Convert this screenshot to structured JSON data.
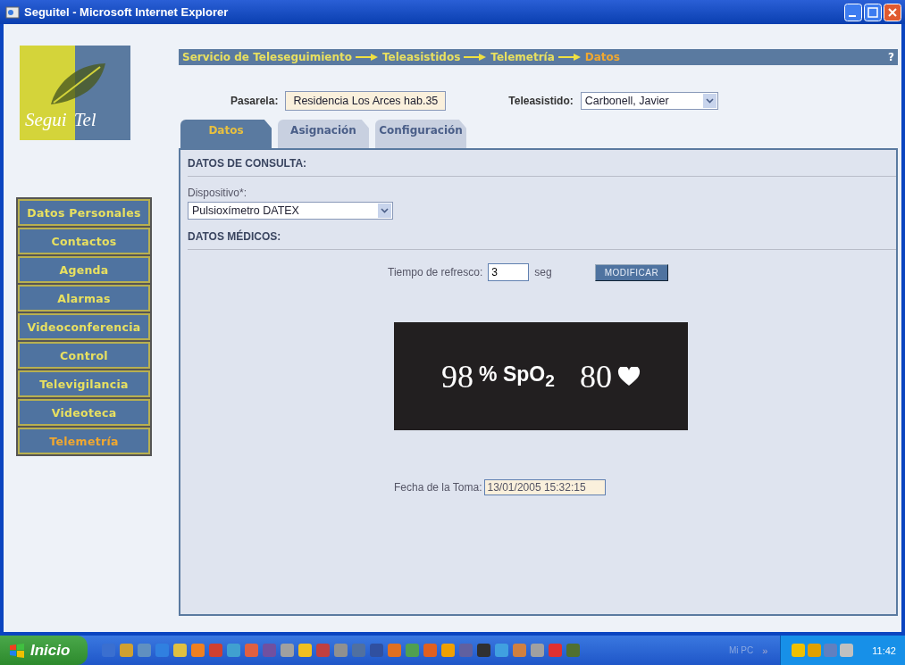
{
  "window": {
    "title": "Seguitel - Microsoft Internet Explorer"
  },
  "logo": {
    "text_1": "Segui",
    "text_2": "Tel"
  },
  "breadcrumb": {
    "items": [
      "Servicio de Teleseguimiento",
      "Teleasistidos",
      "Telemetría",
      "Datos"
    ],
    "help": "?"
  },
  "gateway": {
    "label": "Pasarela:",
    "value": "Residencia Los Arces hab.35"
  },
  "patient": {
    "label": "Teleasistido:",
    "value": "Carbonell, Javier"
  },
  "tabs": [
    {
      "label": "Datos",
      "selected": true
    },
    {
      "label": "Asignación",
      "selected": false
    },
    {
      "label": "Configuración",
      "selected": false
    }
  ],
  "sidebar": {
    "items": [
      {
        "label": "Datos Personales",
        "selected": false
      },
      {
        "label": "Contactos",
        "selected": false
      },
      {
        "label": "Agenda",
        "selected": false
      },
      {
        "label": "Alarmas",
        "selected": false
      },
      {
        "label": "Videoconferencia",
        "selected": false
      },
      {
        "label": "Control",
        "selected": false
      },
      {
        "label": "Televigilancia",
        "selected": false
      },
      {
        "label": "Videoteca",
        "selected": false
      },
      {
        "label": "Telemetría",
        "selected": true
      }
    ]
  },
  "query": {
    "heading": "DATOS DE CONSULTA:",
    "device_label": "Dispositivo*:",
    "device_value": "Pulsioxímetro DATEX"
  },
  "medical": {
    "heading": "DATOS MÉDICOS:",
    "refresh_label": "Tiempo de refresco:",
    "refresh_value": "3",
    "refresh_unit": "seg",
    "button": "MODIFICAR",
    "monitor": {
      "spo2_value": "98",
      "spo2_label": "% SpO$_{2}$",
      "pulse_value": "80"
    },
    "date_label": "Fecha de la Toma:",
    "date_value": "13/01/2005 15:32:15"
  },
  "taskbar": {
    "start": "Inicio",
    "desk_label": "Mi PC",
    "chevron": "»",
    "clock": "11:42"
  }
}
